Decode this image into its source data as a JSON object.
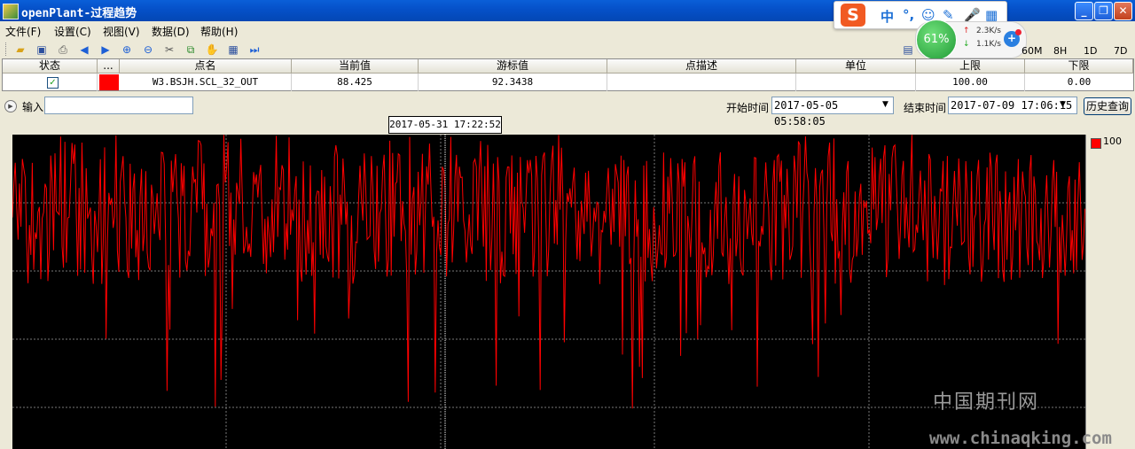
{
  "window": {
    "title": "openPlant-过程趋势",
    "minimize": "_",
    "maximize": "❐",
    "close": "✕"
  },
  "ime": {
    "logo": "S",
    "items": [
      "中",
      "°,",
      "☺",
      "✎",
      "🎤",
      "▦"
    ]
  },
  "net_monitor": {
    "cpu": "61%",
    "up": "2.3K/s",
    "down": "1.1K/s",
    "plus": "+"
  },
  "menu": [
    {
      "label": "文件(F)"
    },
    {
      "label": "设置(C)"
    },
    {
      "label": "视图(V)"
    },
    {
      "label": "数据(D)"
    },
    {
      "label": "帮助(H)"
    }
  ],
  "toolbar": {
    "icons": [
      "open-folder-icon",
      "save-icon",
      "print-icon",
      "arrow-left-icon",
      "arrow-right-icon",
      "zoom-in-icon",
      "zoom-out-icon",
      "tools-icon",
      "link-icon",
      "hand-icon",
      "table-icon",
      "skip-end-icon"
    ],
    "ranges": [
      "60M",
      "8H",
      "1D",
      "7D"
    ]
  },
  "table": {
    "headers": {
      "status": "状态",
      "more": "...",
      "name": "点名",
      "current": "当前值",
      "cursor": "游标值",
      "desc": "点描述",
      "unit": "单位",
      "upper": "上限",
      "lower": "下限"
    },
    "row": {
      "status_checked": "✓",
      "name": "W3.BSJH.SCL_32_OUT",
      "current": "88.425",
      "cursor": "92.3438",
      "desc": "",
      "unit": "",
      "upper": "100.00",
      "lower": "0.00",
      "color": "#ff0000"
    }
  },
  "query": {
    "input_label": "输入",
    "input_value": "",
    "start_label": "开始时间",
    "start_value": "2017-05-05  05:58:05",
    "end_label": "结束时间",
    "end_value": "2017-07-09  17:06:15",
    "history_button": "历史查询"
  },
  "cursor_time": "2017-05-31  17:22:52",
  "chart_data": {
    "type": "line",
    "series": [
      {
        "name": "",
        "color": "#ff0000"
      }
    ],
    "y_axis_top_label": "100",
    "ylim": [
      0,
      100
    ],
    "x_range": [
      "2017-05-05 05:58:05",
      "2017-07-09 17:06:15"
    ],
    "cursor_x": "2017-05-31 17:22:52",
    "grid": true,
    "background": "#000000"
  },
  "watermark": {
    "cn": "中国期刊网",
    "url": "www.chinaqking.com"
  }
}
